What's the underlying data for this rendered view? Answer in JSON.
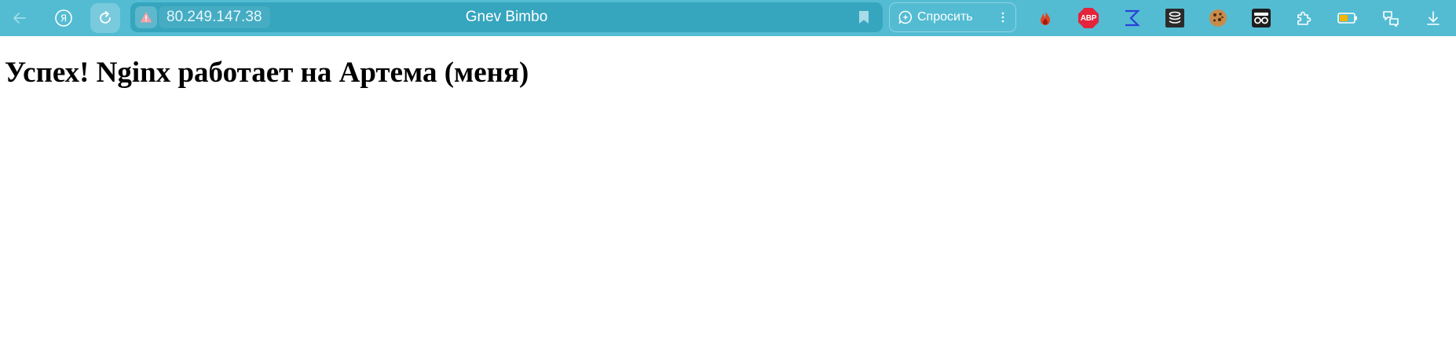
{
  "browser": {
    "address_bar": {
      "url": "80.249.147.38",
      "security_state": "warning-icon"
    },
    "tab_title": "Gnev Bimbo",
    "ask_button": {
      "label": "Спросить",
      "icon": "chat-sparkle-icon"
    },
    "nav_icons": [
      "back-arrow-icon",
      "yandex-logo-icon",
      "reload-icon"
    ],
    "extensions": [
      "flame-extension-icon",
      "adblock-plus-icon",
      "sigma-extension-icon",
      "database-stack-icon",
      "cookie-icon",
      "spy-glasses-icon",
      "puzzle-extensions-icon",
      "battery-icon",
      "translate-icon",
      "download-icon"
    ],
    "abp_text": "ABP",
    "colors": {
      "toolbar": "#53bcd3",
      "address_bar": "#36a5be",
      "abp_red": "#e3243b",
      "battery_fill": "#f5b400",
      "flame": "#e1431e"
    }
  },
  "page": {
    "heading": "Успех! Nginx работает на Артема (меня)"
  }
}
